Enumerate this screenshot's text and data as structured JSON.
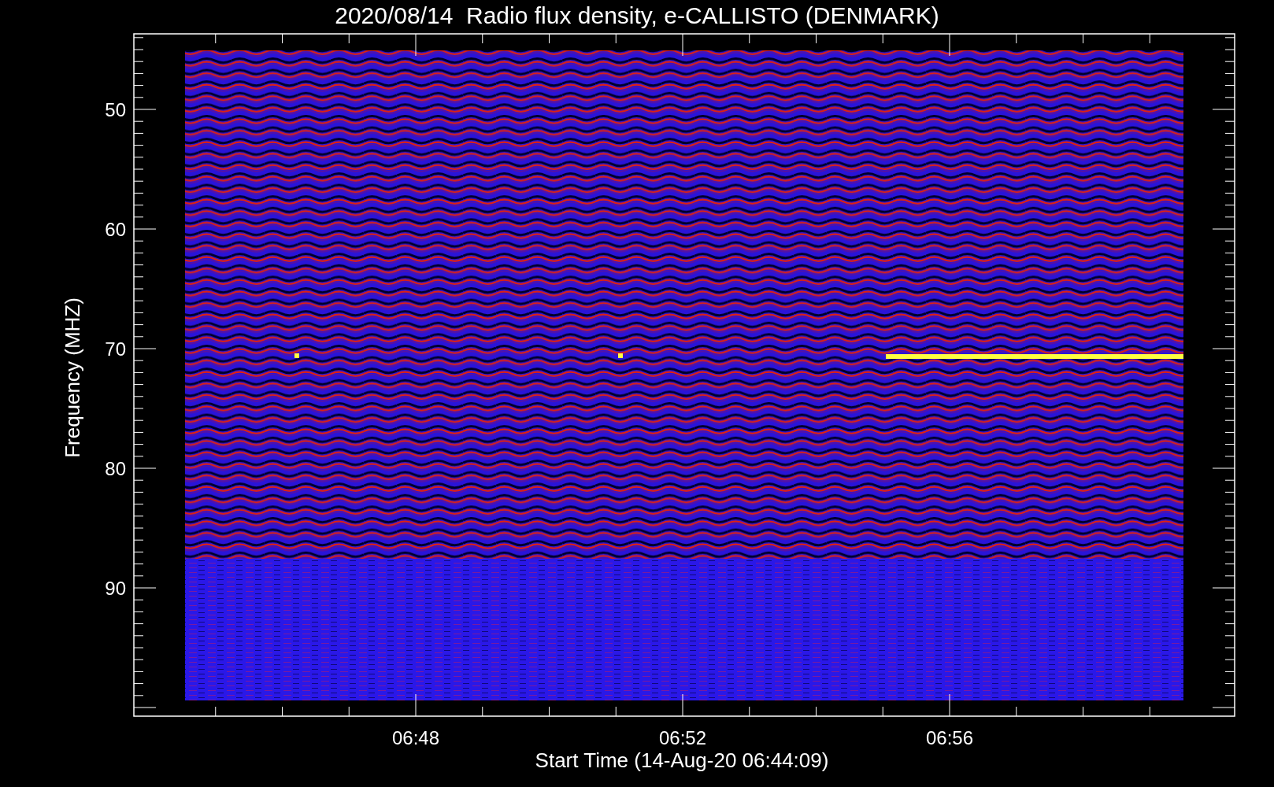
{
  "plot": {
    "title": "2020/08/14  Radio flux density, e-CALLISTO (DENMARK)",
    "xlabel": "Start Time (14-Aug-20 06:44:09)",
    "ylabel": "Frequency (MHZ)",
    "y_tick_labels": [
      "50",
      "60",
      "70",
      "80",
      "90"
    ],
    "x_tick_labels": [
      "06:48",
      "06:52",
      "06:56"
    ]
  }
}
